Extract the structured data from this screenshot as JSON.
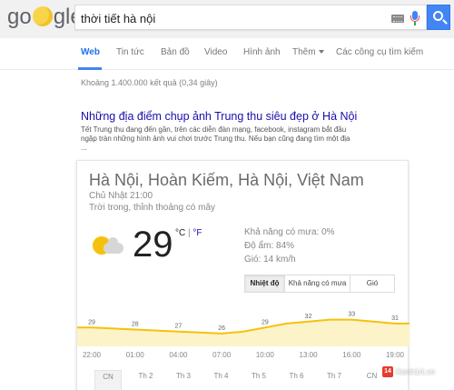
{
  "header": {
    "logo": {
      "part1": "go",
      "part2": "gle"
    },
    "search_query": "thời tiết hà nội"
  },
  "tabs": [
    {
      "label": "Web",
      "active": true
    },
    {
      "label": "Tin tức"
    },
    {
      "label": "Bản đồ"
    },
    {
      "label": "Video"
    },
    {
      "label": "Hình ảnh"
    },
    {
      "label": "Thêm"
    },
    {
      "label": "Các công cụ tìm kiếm"
    }
  ],
  "stats": "Khoảng 1.400.000 kết quả (0,34 giây)",
  "result": {
    "title": "Những địa điểm chụp ảnh Trung thu siêu đẹp ở Hà Nội",
    "snippet": "Tết Trung thu đang đến gần, trên các diễn đàn mạng, facebook, instagram bắt đầu ngập tràn những hình ảnh vui chơi trước Trung thu. Nếu bạn cũng đang tìm một địa ..."
  },
  "weather": {
    "location": "Hà Nội, Hoàn Kiếm, Hà Nội, Việt Nam",
    "time": "Chủ Nhật 21:00",
    "condition": "Trời trong, thỉnh thoảng có mây",
    "icon": "sun-cloud-icon",
    "temperature": "29",
    "unit_c": "°C",
    "unit_sep": " | ",
    "unit_f": "°F",
    "precip": "Khả năng có mưa: 0%",
    "humidity": "Độ ẩm: 84%",
    "wind": "Gió: 14 km/h",
    "tabs": [
      "Nhiệt độ",
      "Khả năng có mưa",
      "Gió"
    ],
    "selected_tab": "Nhiệt độ",
    "days": [
      "CN",
      "Th 2",
      "Th 3",
      "Th 4",
      "Th 5",
      "Th 6",
      "Th 7",
      "CN"
    ],
    "accent_color": "#f4c20d"
  },
  "chart_data": {
    "type": "area",
    "title": "",
    "xlabel": "",
    "ylabel": "",
    "x": [
      "22:00",
      "",
      "01:00",
      "",
      "04:00",
      "",
      "07:00",
      "",
      "10:00",
      "",
      "13:00",
      "",
      "16:00",
      "",
      "19:00"
    ],
    "x_ticks": [
      "22:00",
      "01:00",
      "04:00",
      "07:00",
      "10:00",
      "13:00",
      "16:00",
      "19:00"
    ],
    "values": [
      29,
      28.5,
      28,
      27.5,
      27,
      26.5,
      26,
      27,
      29,
      31,
      32,
      33,
      33,
      32,
      31
    ],
    "labeled_points": [
      {
        "index": 0,
        "value": 29
      },
      {
        "index": 2,
        "value": 28
      },
      {
        "index": 4,
        "value": 27
      },
      {
        "index": 6,
        "value": 26
      },
      {
        "index": 8,
        "value": 29
      },
      {
        "index": 10,
        "value": 32
      },
      {
        "index": 12,
        "value": 33
      },
      {
        "index": 14,
        "value": 31
      }
    ],
    "ylim": [
      20,
      36
    ],
    "color": "#f4c20d",
    "fill_color": "#fdf3c9"
  },
  "watermark": {
    "badge": "14",
    "text": "Kenh14.vn"
  }
}
